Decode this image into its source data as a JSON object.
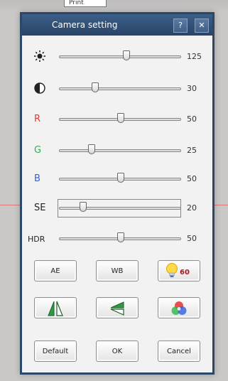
{
  "background": {
    "print_label": "Print"
  },
  "dialog": {
    "title": "Camera setting",
    "help_label": "?",
    "close_label": "✕",
    "sliders": [
      {
        "id": "brightness",
        "icon": "brightness-icon",
        "label": "",
        "value": 125,
        "position": 0.56,
        "label_color": "#222222"
      },
      {
        "id": "contrast",
        "icon": "contrast-icon",
        "label": "",
        "value": 30,
        "position": 0.3,
        "label_color": "#222222"
      },
      {
        "id": "red",
        "label": "R",
        "value": 50,
        "position": 0.51,
        "label_color": "#e03a3a"
      },
      {
        "id": "green",
        "label": "G",
        "value": 25,
        "position": 0.27,
        "label_color": "#3aa858"
      },
      {
        "id": "blue",
        "label": "B",
        "value": 50,
        "position": 0.51,
        "label_color": "#3a5fd0"
      },
      {
        "id": "se",
        "label": "SE",
        "value": 20,
        "position": 0.2,
        "label_color": "#222222"
      },
      {
        "id": "hdr",
        "label": "HDR",
        "value": 50,
        "position": 0.51,
        "label_color": "#222222"
      }
    ],
    "buttons": {
      "ae": "AE",
      "wb": "WB",
      "lamp_value": "60",
      "default": "Default",
      "ok": "OK",
      "cancel": "Cancel"
    },
    "icons": [
      "lightbulb-icon",
      "mirror-flip-icon",
      "rotate-flip-icon",
      "color-wheel-icon"
    ],
    "colors": {
      "titlebar": "#2d4768",
      "lamp_value": "#b3121b"
    }
  }
}
